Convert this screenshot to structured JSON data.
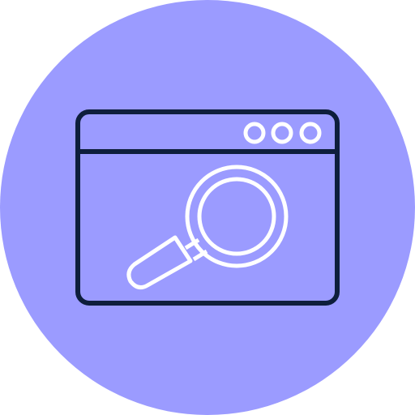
{
  "icon": {
    "name": "browser-search-icon",
    "colors": {
      "background_circle": "#9b9bff",
      "window_stroke": "#0e1e3c",
      "magnifier_stroke": "#ffffff",
      "dots_stroke": "#ffffff"
    }
  }
}
